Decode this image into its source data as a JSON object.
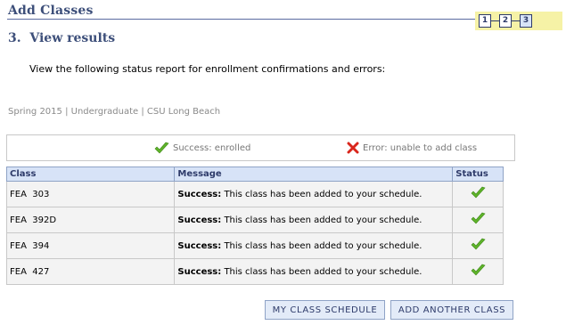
{
  "header": {
    "title": "Add Classes",
    "steps": [
      "1",
      "2",
      "3"
    ],
    "current_step": "3",
    "subtitle": "3.  View results"
  },
  "instructions": "View the following status report for enrollment confirmations and errors:",
  "term_info": "Spring 2015 | Undergraduate | CSU Long Beach",
  "legend": {
    "success_label": "Success: enrolled",
    "error_label": "Error: unable to add class",
    "success_icon": "green-check-icon",
    "error_icon": "red-x-icon",
    "success_color": "#5fb32a",
    "error_color": "#d9261c"
  },
  "table": {
    "headers": [
      "Class",
      "Message",
      "Status"
    ],
    "rows": [
      {
        "class": "FEA  303",
        "message_bold": "Success:",
        "message_text": " This class has been added to your schedule.",
        "status": "success"
      },
      {
        "class": "FEA  392D",
        "message_bold": "Success:",
        "message_text": " This class has been added to your schedule.",
        "status": "success"
      },
      {
        "class": "FEA  394",
        "message_bold": "Success:",
        "message_text": " This class has been added to your schedule.",
        "status": "success"
      },
      {
        "class": "FEA  427",
        "message_bold": "Success:",
        "message_text": " This class has been added to your schedule.",
        "status": "success"
      }
    ]
  },
  "buttons": {
    "my_class_schedule": "My Class Schedule",
    "add_another_class": "Add Another Class"
  }
}
